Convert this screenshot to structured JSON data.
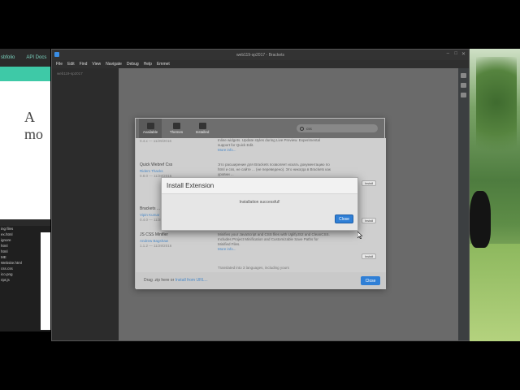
{
  "bg_browser": {
    "nav_items": [
      "sbfolio",
      "API Docs"
    ],
    "hero_text": "A mo"
  },
  "bg_editor": {
    "lines": [
      "ing files",
      "ex.html",
      "",
      "",
      "ignore",
      "html",
      "html",
      "ME",
      "Website.html",
      "",
      "",
      "css.css",
      "ico.png",
      "ript.js"
    ]
  },
  "window": {
    "title": "web119-sp2017 - Brackets",
    "menu": [
      "File",
      "Edit",
      "Find",
      "View",
      "Navigate",
      "Debug",
      "Help",
      "Emmet"
    ],
    "project": "web119-sp2017"
  },
  "ext_manager": {
    "tabs": [
      {
        "label": "Available",
        "icon": "available-icon"
      },
      {
        "label": "Themes",
        "icon": "themes-icon"
      },
      {
        "label": "Installed",
        "icon": "installed-icon"
      }
    ],
    "search_value": "css",
    "rows": [
      {
        "name": "",
        "author": "",
        "version": "0.4.x — 11/29/2016",
        "desc": "Inline widgets. Update styles during Live Preview. Experimental support for Quick Edit.",
        "more": "More info...",
        "install": ""
      },
      {
        "name": "Quick Webref Css",
        "author": "Ridem Thacks",
        "version": "0.8.0 — 11/29/2016",
        "desc": "Это расширение для Brackets позволяет искать документацию по html и css, не сайте ... (не переведено). Это никогда в Brackets как уровни ...",
        "more": "",
        "install": "Install"
      },
      {
        "name": "Brackets ...",
        "author": "Vipin Kumar",
        "version": "0.4.0 — 11/29/2016",
        "desc": "",
        "more": "",
        "install": "Install"
      },
      {
        "name": "JS CSS Minifier",
        "author": "Andrew Bagshaw",
        "version": "1.1.2 — 11/29/2016",
        "desc": "Minifies your JavaScript and CSS files with UglifyJS2 and CleanCSS. Includes Project Minification and Customizable Save Paths for Minified Files.",
        "more": "More info...",
        "install": "Install"
      }
    ],
    "translated": "Translated into 3 languages, including yours",
    "footer_text": "Drag .zip here or",
    "footer_link": "Install from URL...",
    "close_label": "Close"
  },
  "install_dialog": {
    "title": "Install Extension",
    "message": "Installation successful!",
    "close_label": "Close"
  },
  "colors": {
    "accent": "#2f7fd6",
    "teal": "#3ec9a7"
  }
}
